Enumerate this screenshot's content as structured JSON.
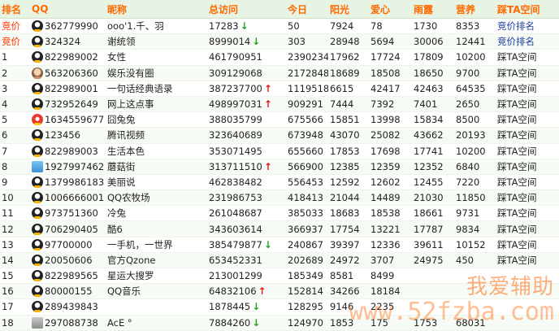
{
  "headers": [
    "排名",
    "QQ",
    "昵称",
    "总访问",
    "今日",
    "阳光",
    "爱心",
    "雨露",
    "营养",
    "踩TA空间"
  ],
  "rows": [
    {
      "rank": "竞价",
      "qq": "362779990",
      "nick": "ooo'1.千、羽",
      "total": "17283",
      "trend": "down",
      "today": "50",
      "sun": "7924",
      "love": "78",
      "rain": "1730",
      "nutri": "8353",
      "action": "竞价排名",
      "avatar": "default"
    },
    {
      "rank": "竞价",
      "qq": "324324",
      "nick": "谢统领",
      "total": "8999014",
      "trend": "down",
      "today": "303",
      "sun": "28948",
      "love": "5694",
      "rain": "30006",
      "nutri": "12441",
      "action": "竞价排名",
      "avatar": "default"
    },
    {
      "rank": "1",
      "qq": "822989002",
      "nick": "女性",
      "total": "461790951",
      "trend": "",
      "today": "2390234",
      "sun": "17962",
      "love": "17724",
      "rain": "17809",
      "nutri": "10200",
      "action": "踩TA空间",
      "avatar": "default"
    },
    {
      "rank": "2",
      "qq": "563206360",
      "nick": "娱乐没有圈",
      "total": "309129068",
      "trend": "",
      "today": "2172848",
      "sun": "18689",
      "love": "18508",
      "rain": "18650",
      "nutri": "9700",
      "action": "踩TA空间",
      "avatar": "photo"
    },
    {
      "rank": "3",
      "qq": "822989001",
      "nick": "一句话经典语录",
      "total": "387237700",
      "trend": "up",
      "today": "1119518",
      "sun": "6615",
      "love": "42417",
      "rain": "42463",
      "nutri": "64535",
      "action": "踩TA空间",
      "avatar": "default"
    },
    {
      "rank": "4",
      "qq": "732952649",
      "nick": "网上这点事",
      "total": "498997031",
      "trend": "up",
      "today": "909291",
      "sun": "7444",
      "love": "7392",
      "rain": "7401",
      "nutri": "2650",
      "action": "踩TA空间",
      "avatar": "default"
    },
    {
      "rank": "5",
      "qq": "1634559677",
      "nick": "囧兔兔",
      "total": "388035799",
      "trend": "",
      "today": "675566",
      "sun": "15851",
      "love": "13998",
      "rain": "15834",
      "nutri": "8500",
      "action": "踩TA空间",
      "avatar": "red"
    },
    {
      "rank": "6",
      "qq": "123456",
      "nick": "腾讯视频",
      "total": "323640689",
      "trend": "",
      "today": "673948",
      "sun": "43070",
      "love": "25082",
      "rain": "43662",
      "nutri": "20193",
      "action": "踩TA空间",
      "avatar": "default"
    },
    {
      "rank": "7",
      "qq": "822989003",
      "nick": "生活本色",
      "total": "353071495",
      "trend": "",
      "today": "655660",
      "sun": "17853",
      "love": "17698",
      "rain": "17741",
      "nutri": "10200",
      "action": "踩TA空间",
      "avatar": "default"
    },
    {
      "rank": "8",
      "qq": "1927997462",
      "nick": "蘑菇街",
      "total": "313711510",
      "trend": "up",
      "today": "566900",
      "sun": "12385",
      "love": "12359",
      "rain": "12352",
      "nutri": "6840",
      "action": "踩TA空间",
      "avatar": "square"
    },
    {
      "rank": "9",
      "qq": "1379986183",
      "nick": "美丽说",
      "total": "462838482",
      "trend": "",
      "today": "556453",
      "sun": "12592",
      "love": "12602",
      "rain": "12455",
      "nutri": "7220",
      "action": "踩TA空间",
      "avatar": "default"
    },
    {
      "rank": "10",
      "qq": "1006666001",
      "nick": "QQ农牧场",
      "total": "231986753",
      "trend": "",
      "today": "418413",
      "sun": "21044",
      "love": "14489",
      "rain": "21030",
      "nutri": "11850",
      "action": "踩TA空间",
      "avatar": "default"
    },
    {
      "rank": "11",
      "qq": "973751360",
      "nick": "冷兔",
      "total": "261048687",
      "trend": "",
      "today": "385033",
      "sun": "18683",
      "love": "18538",
      "rain": "18661",
      "nutri": "9731",
      "action": "踩TA空间",
      "avatar": "default"
    },
    {
      "rank": "12",
      "qq": "706290405",
      "nick": "酷6",
      "total": "343603614",
      "trend": "",
      "today": "366937",
      "sun": "17754",
      "love": "13221",
      "rain": "17787",
      "nutri": "9834",
      "action": "踩TA空间",
      "avatar": "default"
    },
    {
      "rank": "13",
      "qq": "97700000",
      "nick": "一手机，一世界",
      "total": "385479877",
      "trend": "down",
      "today": "240867",
      "sun": "39397",
      "love": "12336",
      "rain": "39611",
      "nutri": "10152",
      "action": "踩TA空间",
      "avatar": "default"
    },
    {
      "rank": "14",
      "qq": "20050606",
      "nick": "官方Qzone",
      "total": "653452331",
      "trend": "",
      "today": "202689",
      "sun": "24972",
      "love": "3707",
      "rain": "24975",
      "nutri": "450",
      "action": "踩TA空间",
      "avatar": "default"
    },
    {
      "rank": "15",
      "qq": "822989565",
      "nick": "星运大搜罗",
      "total": "213001299",
      "trend": "",
      "today": "185349",
      "sun": "8581",
      "love": "8499",
      "rain": "",
      "nutri": "",
      "action": "",
      "avatar": "default"
    },
    {
      "rank": "16",
      "qq": "80000155",
      "nick": "QQ音乐",
      "total": "64832106",
      "trend": "up",
      "today": "152814",
      "sun": "34266",
      "love": "18184",
      "rain": "",
      "nutri": "",
      "action": "",
      "avatar": "default"
    },
    {
      "rank": "17",
      "qq": "289439843",
      "nick": "",
      "total": "1878445",
      "trend": "down",
      "today": "128295",
      "sun": "9146",
      "love": "2235",
      "rain": "",
      "nutri": "",
      "action": "",
      "avatar": "default"
    },
    {
      "rank": "18",
      "qq": "297088738",
      "nick": "AcE °",
      "total": "7884260",
      "trend": "down",
      "today": "124970",
      "sun": "1853",
      "love": "175",
      "rain": "1753",
      "nutri": "68031",
      "action": "",
      "avatar": "gray"
    }
  ],
  "watermark": {
    "line1": "我爱辅助",
    "line2": "www.52fzba.com"
  },
  "colors": {
    "header_text": "#ff6a00",
    "header_bg": "#e7f3e3",
    "arrow_up": "#e21a1a",
    "arrow_down": "#23a323",
    "link": "#1a3ea0"
  }
}
